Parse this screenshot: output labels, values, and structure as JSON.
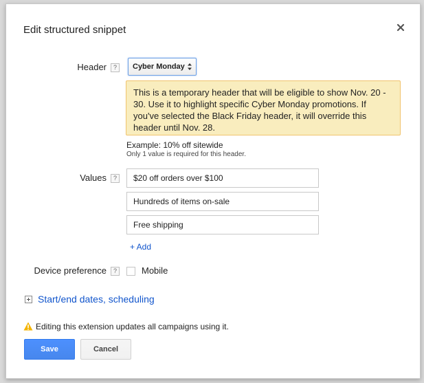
{
  "dialog": {
    "title": "Edit structured snippet",
    "close_icon": "close-icon"
  },
  "header_field": {
    "label": "Header",
    "help": "?",
    "selected": "Cyber Monday",
    "info": "This is a temporary header that will be eligible to show Nov. 20 - 30. Use it to highlight specific Cyber Monday promotions. If you've selected the Black Friday header, it will override this header until Nov. 28.",
    "example": "Example: 10% off sitewide",
    "hint": "Only 1 value is required for this header."
  },
  "values_field": {
    "label": "Values",
    "help": "?",
    "items": [
      "$20 off orders over $100",
      "Hundreds of items on-sale",
      "Free shipping"
    ],
    "add_label": "+ Add"
  },
  "device_field": {
    "label": "Device preference",
    "help": "?",
    "checkbox_label": "Mobile"
  },
  "scheduling": {
    "label": "Start/end dates, scheduling"
  },
  "warning": {
    "icon": "warning-icon",
    "text": "Editing this extension updates all campaigns using it."
  },
  "actions": {
    "save_label": "Save",
    "cancel_label": "Cancel"
  },
  "colors": {
    "primary_button": "#4d90fe",
    "link": "#1155cc",
    "info_background": "#f9edbe",
    "warning": "#f4b400"
  }
}
